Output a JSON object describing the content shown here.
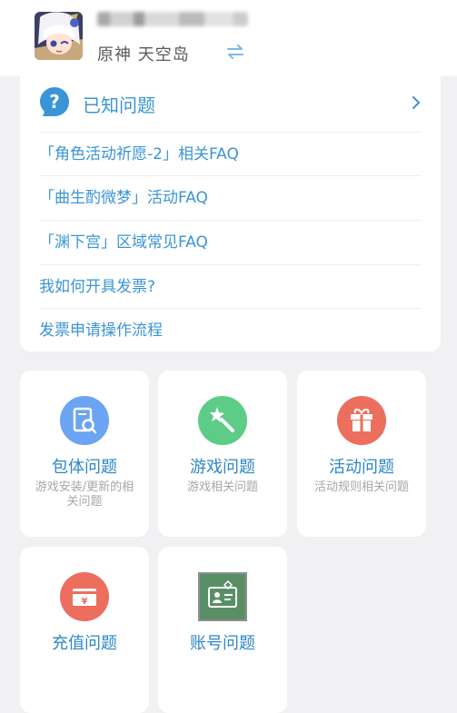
{
  "header": {
    "subtitle": "原神  天空岛",
    "accent": "#3a95d6"
  },
  "faq": {
    "title": "已知问题",
    "items": [
      "「角色活动祈愿-2」相关FAQ",
      "「曲生酌微梦」活动FAQ",
      "「渊下宫」区域常见FAQ",
      "我如何开具发票?",
      "发票申请操作流程"
    ]
  },
  "categories": [
    {
      "title": "包体问题",
      "desc": "游戏安装/更新的相关问题",
      "icon": "package-search-icon",
      "color": "#6aa4f2"
    },
    {
      "title": "游戏问题",
      "desc": "游戏相关问题",
      "icon": "magic-wand-icon",
      "color": "#5dcc86"
    },
    {
      "title": "活动问题",
      "desc": "活动规则相关问题",
      "icon": "gift-icon",
      "color": "#ec6e5f"
    },
    {
      "title": "充值问题",
      "desc": "",
      "icon": "yen-card-icon",
      "color": "#ec6e5f"
    },
    {
      "title": "账号问题",
      "desc": "",
      "icon": "id-card-icon",
      "color": "#5a8f66"
    }
  ]
}
